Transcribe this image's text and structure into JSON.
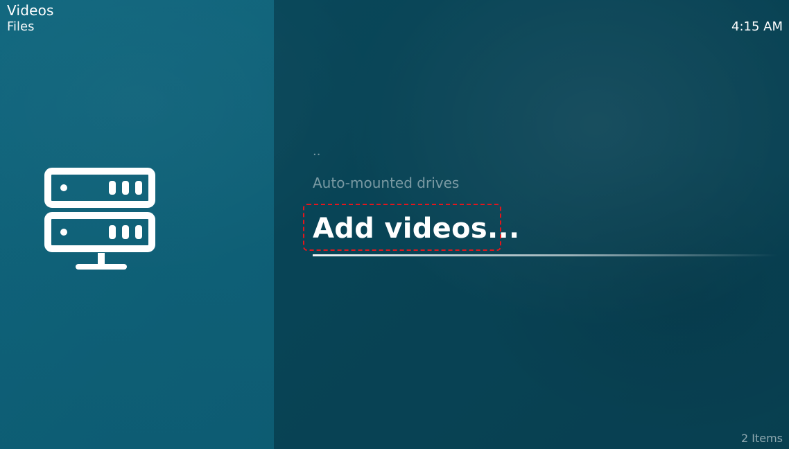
{
  "header": {
    "title": "Videos",
    "subtitle": "Files",
    "clock": "4:15 AM"
  },
  "side_icon": "server-icon",
  "list": {
    "items": [
      {
        "label": "..",
        "selected": false
      },
      {
        "label": "Auto-mounted drives",
        "selected": false
      },
      {
        "label": "Add videos...",
        "selected": true
      }
    ]
  },
  "footer": {
    "item_count": "2 Items"
  },
  "colors": {
    "background": "#0d5468",
    "focus_outline": "#e3161c",
    "text": "#ffffff"
  }
}
